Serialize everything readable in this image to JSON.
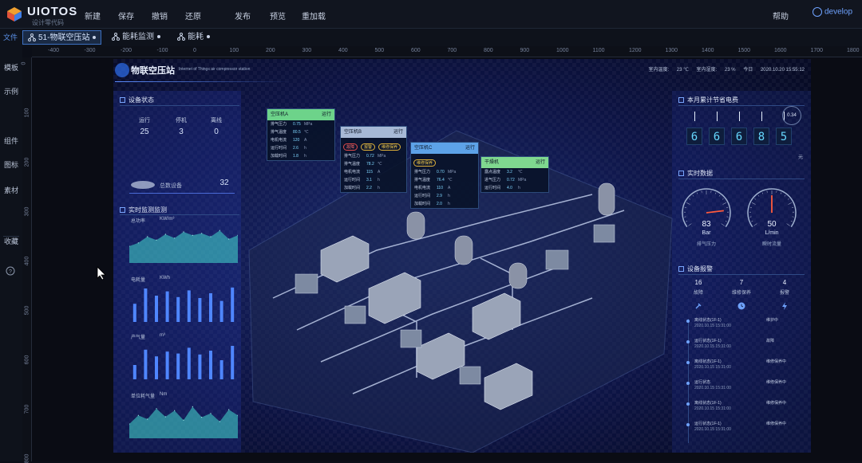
{
  "app": {
    "name": "UIOTOS",
    "tagline": "设计零代码"
  },
  "topbar": {
    "menus": [
      "新建",
      "保存",
      "撤销",
      "还原",
      "发布",
      "预览",
      "重加载"
    ],
    "help": "帮助",
    "user": "develop"
  },
  "tabbar": {
    "file_label": "文件",
    "tabs": [
      {
        "label": "51-物联空压站",
        "active": true
      },
      {
        "label": "能耗监测",
        "active": false
      },
      {
        "label": "能耗",
        "active": false
      }
    ]
  },
  "ruler": {
    "h_ticks": [
      "-400",
      "-300",
      "-200",
      "-100",
      "0",
      "100",
      "200",
      "300",
      "400",
      "500",
      "600",
      "700",
      "800",
      "900",
      "1000",
      "1100",
      "1200",
      "1300",
      "1400",
      "1500",
      "1600",
      "1700",
      "1800"
    ],
    "v_ticks": [
      "0",
      "100",
      "200",
      "300",
      "400",
      "500",
      "600",
      "700",
      "800"
    ]
  },
  "left_nav": [
    "模板",
    "示例",
    "组件",
    "图标",
    "素材",
    "收藏"
  ],
  "dashboard": {
    "title": "物联空压站",
    "subtitle": "Internet of Things air compressor station",
    "weather": {
      "temp_label": "室内温度:",
      "temp_value": "23 ℃",
      "humid_label": "室内湿度:",
      "humid_value": "23 %",
      "date_label": "今日",
      "datetime": "2020.10.20 15:55:12"
    },
    "device_status": {
      "title": "设备状态",
      "items": [
        {
          "label": "运行",
          "value": "25"
        },
        {
          "label": "停机",
          "value": "3"
        },
        {
          "label": "离线",
          "value": "0"
        }
      ],
      "total_label": "总数设备",
      "total_value": "32"
    },
    "realtime": {
      "title": "实时监测监测",
      "charts": [
        {
          "label": "总功率",
          "unit": "KW/m³",
          "values": [
            35,
            42,
            55,
            48,
            60,
            52,
            65,
            58,
            62,
            55,
            68,
            50,
            58
          ]
        },
        {
          "label": "电耗量",
          "unit": "KWh",
          "values": [
            38,
            70,
            55,
            64,
            52,
            66,
            50,
            60,
            44,
            72
          ]
        },
        {
          "label": "产气量",
          "unit": "m³",
          "values": [
            30,
            62,
            48,
            58,
            54,
            66,
            52,
            60,
            40,
            70
          ]
        },
        {
          "label": "单位耗气量",
          "unit": "Nm",
          "values": [
            30,
            48,
            40,
            62,
            45,
            58,
            38,
            66,
            44,
            52,
            35,
            60,
            48
          ]
        }
      ]
    },
    "cards": [
      {
        "title": "空压机A",
        "status": "运行",
        "pills": [],
        "color": "#6dd38a",
        "rows": [
          [
            "排气压力",
            "0.75",
            "MPa"
          ],
          [
            "排气温度",
            "80.5",
            "℃"
          ],
          [
            "电机电流",
            "120",
            "A"
          ],
          [
            "运行时间",
            "2.6",
            "h"
          ],
          [
            "加载时间",
            "1.8",
            "h"
          ]
        ]
      },
      {
        "title": "空压机B",
        "status": "运行",
        "pills": [
          "故障",
          "报警",
          "维修保养"
        ],
        "color": "#a7b9d6",
        "rows": [
          [
            "排气压力",
            "0.72",
            "MPa"
          ],
          [
            "排气温度",
            "78.2",
            "℃"
          ],
          [
            "电机电流",
            "115",
            "A"
          ],
          [
            "运行时间",
            "3.1",
            "h"
          ],
          [
            "加载时间",
            "2.2",
            "h"
          ]
        ]
      },
      {
        "title": "空压机C",
        "status": "运行",
        "pills": [
          "维修保养"
        ],
        "color": "#5da2e8",
        "rows": [
          [
            "排气压力",
            "0.70",
            "MPa"
          ],
          [
            "排气温度",
            "76.4",
            "℃"
          ],
          [
            "电机电流",
            "110",
            "A"
          ],
          [
            "运行时间",
            "2.9",
            "h"
          ],
          [
            "加载时间",
            "2.0",
            "h"
          ]
        ]
      },
      {
        "title": "干燥机",
        "status": "运行",
        "pills": [],
        "color": "#7fd88f",
        "rows": [
          [
            "露点温度",
            "3.2",
            "℃"
          ],
          [
            "进气压力",
            "0.72",
            "MPa"
          ],
          [
            "运行时间",
            "4.0",
            "h"
          ]
        ]
      }
    ],
    "budget": {
      "title": "本月累计节省电费",
      "digits": [
        "6",
        "6",
        "6",
        "8",
        "5"
      ],
      "badge": "0.34",
      "unit": "元"
    },
    "realdata": {
      "title": "实时数据",
      "gauges": [
        {
          "value": "83",
          "unit": "Bar",
          "caption": "排气压力",
          "fraction": 0.83
        },
        {
          "value": "50",
          "unit": "L/min",
          "caption": "瞬时流量",
          "fraction": 0.5
        }
      ]
    },
    "equipment": {
      "title": "设备报警",
      "stats": [
        {
          "value": "16",
          "label": "故障",
          "icon": "wrench-icon"
        },
        {
          "value": "7",
          "label": "维修保养",
          "icon": "clock-icon"
        },
        {
          "value": "4",
          "label": "报警",
          "icon": "bolt-icon"
        }
      ],
      "feed": [
        {
          "name": "离线状态(1F-1)",
          "time": "2020.10.15  15:31:00",
          "status": "维护中"
        },
        {
          "name": "运行状态(1F-1)",
          "time": "2020.10.15  15:31:00",
          "status": "故障"
        },
        {
          "name": "离线状态(1F-1)",
          "time": "2020.10.15  15:31:00",
          "status": "维修保养中"
        },
        {
          "name": "运行状态",
          "time": "2020.10.15  15:31:00",
          "status": "维修保养中"
        },
        {
          "name": "离线状态(1F-1)",
          "time": "2020.10.15  15:31:00",
          "status": "维修保养中"
        },
        {
          "name": "运行状态(1F-1)",
          "time": "2020.10.15  15:31:00",
          "status": "维修保养中"
        }
      ]
    }
  }
}
